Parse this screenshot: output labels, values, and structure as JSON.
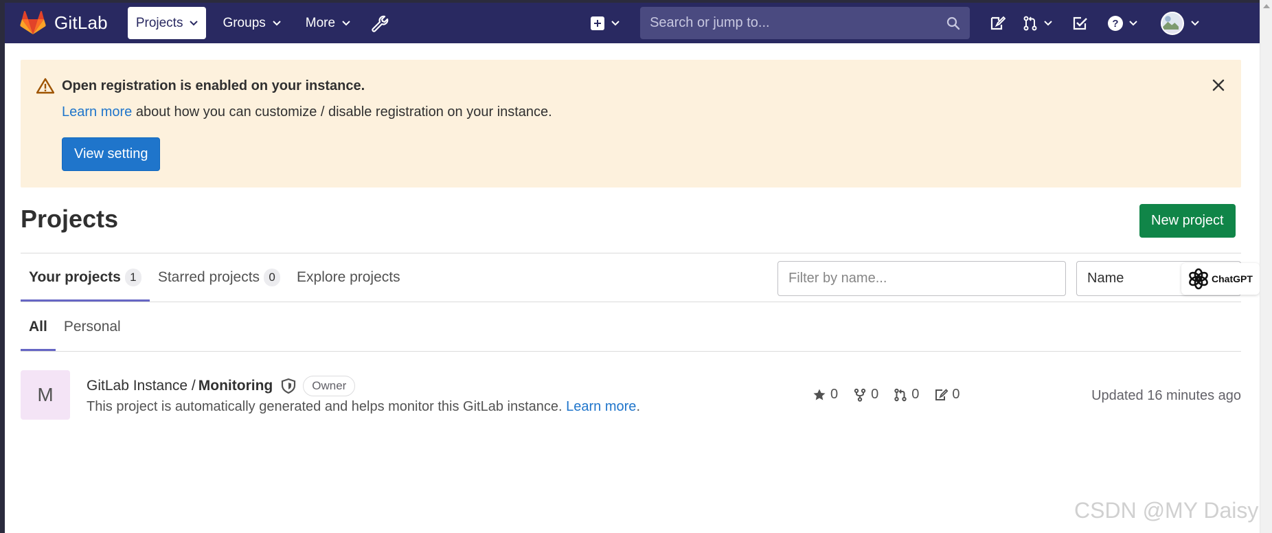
{
  "navbar": {
    "brand": "GitLab",
    "projects_label": "Projects",
    "groups_label": "Groups",
    "more_label": "More",
    "search_placeholder": "Search or jump to..."
  },
  "alert": {
    "title": "Open registration is enabled on your instance.",
    "link": "Learn more",
    "text": " about how you can customize / disable registration on your instance.",
    "button": "View setting"
  },
  "page": {
    "title": "Projects",
    "new_project": "New project"
  },
  "tabs": [
    {
      "label": "Your projects",
      "count": "1"
    },
    {
      "label": "Starred projects",
      "count": "0"
    },
    {
      "label": "Explore projects"
    }
  ],
  "filter": {
    "placeholder": "Filter by name...",
    "sort_value": "Name"
  },
  "chatgpt_badge": "ChatGPT",
  "subtabs": [
    "All",
    "Personal"
  ],
  "project": {
    "avatar_letter": "M",
    "namespace": "GitLab Instance / ",
    "name": "Monitoring",
    "role": "Owner",
    "description": "This project is automatically generated and helps monitor this GitLab instance. ",
    "learn_more": "Learn more",
    "period": ".",
    "stars": "0",
    "forks": "0",
    "merge_requests": "0",
    "issues": "0",
    "updated": "Updated 16 minutes ago"
  },
  "watermark": "CSDN @MY Daisy",
  "colors": {
    "navbar": "#292961",
    "alert_bg": "#fdf1dd",
    "primary": "#1f75cb",
    "success": "#108548",
    "tab_underline": "#6666c4"
  }
}
